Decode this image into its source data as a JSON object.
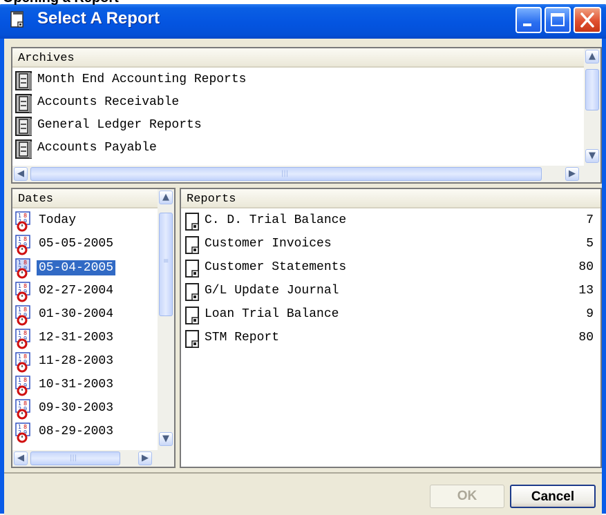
{
  "page_title_partial": "Opening a Report",
  "window": {
    "title": "Select A Report"
  },
  "archives": {
    "header": "Archives",
    "items": [
      "Month End Accounting Reports",
      "Accounts Receivable",
      "General Ledger Reports",
      "Accounts Payable"
    ]
  },
  "dates": {
    "header": "Dates",
    "items": [
      "Today",
      "05-05-2005",
      "05-04-2005",
      "02-27-2004",
      "01-30-2004",
      "12-31-2003",
      "11-28-2003",
      "10-31-2003",
      "09-30-2003",
      "08-29-2003"
    ],
    "selected": "05-04-2005"
  },
  "reports": {
    "header": "Reports",
    "items": [
      {
        "name": "C. D. Trial Balance",
        "count": "7"
      },
      {
        "name": "Customer Invoices",
        "count": "5"
      },
      {
        "name": "Customer Statements",
        "count": "80"
      },
      {
        "name": "G/L Update Journal",
        "count": "13"
      },
      {
        "name": "Loan Trial Balance",
        "count": "9"
      },
      {
        "name": "STM Report",
        "count": "80"
      }
    ]
  },
  "buttons": {
    "ok": "OK",
    "cancel": "Cancel"
  },
  "colors": {
    "titlebar": "#0454e0",
    "selection": "#316ac5",
    "client": "#ece9d8"
  }
}
